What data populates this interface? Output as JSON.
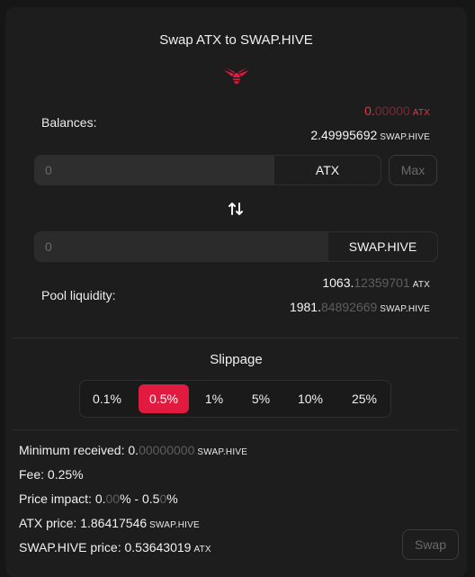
{
  "title": "Swap ATX to SWAP.HIVE",
  "balances": {
    "label": "Balances:",
    "atx": {
      "int": "0.",
      "dec": "00000",
      "unit": "ATX"
    },
    "swaphive": {
      "int": "2.49995692",
      "dec": "",
      "unit": "SWAP.HIVE"
    }
  },
  "from": {
    "value": "",
    "placeholder": "0",
    "token": "ATX",
    "max_label": "Max"
  },
  "to": {
    "value": "",
    "placeholder": "0",
    "token": "SWAP.HIVE"
  },
  "pool": {
    "label": "Pool liquidity:",
    "atx": {
      "int": "1063.",
      "dec": "12359701",
      "unit": "ATX"
    },
    "swaphive": {
      "int": "1981.",
      "dec": "84892669",
      "unit": "SWAP.HIVE"
    }
  },
  "slippage": {
    "label": "Slippage",
    "options": [
      "0.1%",
      "0.5%",
      "1%",
      "5%",
      "10%",
      "25%"
    ],
    "selected": "0.5%"
  },
  "details": {
    "min_received": {
      "label": "Minimum received: ",
      "int": "0.",
      "dec": "00000000",
      "unit": "SWAP.HIVE"
    },
    "fee": {
      "label": "Fee: ",
      "value": "0.25%"
    },
    "price_impact": {
      "label": "Price impact: ",
      "a_int": "0.",
      "a_dec": "00",
      "mid": "% - 0.5",
      "b_dec": "0",
      "end": "%"
    },
    "atx_price": {
      "label": "ATX price: ",
      "value": "1.86417546",
      "unit": "SWAP.HIVE"
    },
    "swaphive_price": {
      "label": "SWAP.HIVE price: ",
      "value": "0.53643019",
      "unit": "ATX"
    }
  },
  "swap_button": "Swap",
  "colors": {
    "accent": "#e31a3f",
    "panel": "#1d1d1d",
    "background": "#161616"
  },
  "icons": {
    "logo": "hive-bee-logo",
    "swap_direction": "swap-arrows-icon"
  }
}
